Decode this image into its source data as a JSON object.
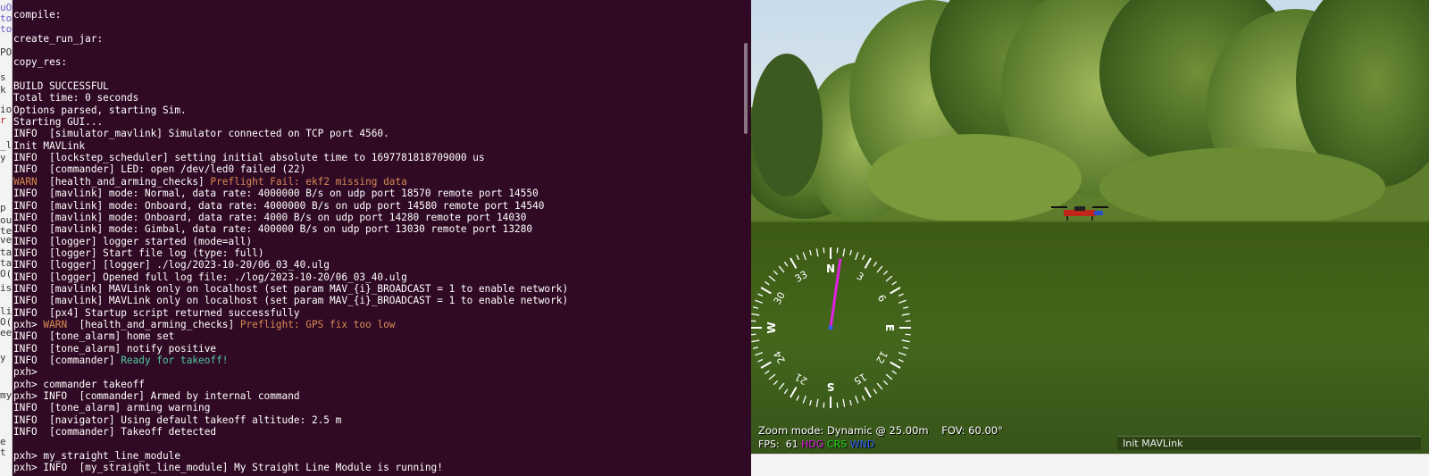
{
  "background_editor": {
    "fragments": [
      "uO",
      "to",
      "to",
      "PO",
      "k",
      "s",
      "io",
      "r",
      "_l",
      "y",
      "p",
      "ou",
      "te",
      "ve",
      "ta",
      "ta",
      "O(",
      "is",
      "li",
      "O(",
      "ee",
      "y",
      "my",
      "e",
      "t"
    ]
  },
  "terminal": {
    "lines": [
      [
        {
          "t": "compile:"
        }
      ],
      [
        {
          "t": ""
        }
      ],
      [
        {
          "t": "create_run_jar:"
        }
      ],
      [
        {
          "t": ""
        }
      ],
      [
        {
          "t": "copy_res:"
        }
      ],
      [
        {
          "t": ""
        }
      ],
      [
        {
          "t": "BUILD SUCCESSFUL"
        }
      ],
      [
        {
          "t": "Total time: 0 seconds"
        }
      ],
      [
        {
          "t": "Options parsed, starting Sim."
        }
      ],
      [
        {
          "t": "Starting GUI..."
        }
      ],
      [
        {
          "t": "INFO  [simulator_mavlink] Simulator connected on TCP port 4560."
        }
      ],
      [
        {
          "t": "Init MAVLink"
        }
      ],
      [
        {
          "t": "INFO  [lockstep_scheduler] setting initial absolute time to 1697781818709000 us"
        }
      ],
      [
        {
          "t": "INFO  [commander] LED: open /dev/led0 failed (22)"
        }
      ],
      [
        {
          "t": "WARN  ",
          "c": "warn"
        },
        {
          "t": "[health_and_arming_checks] "
        },
        {
          "t": "Preflight Fail: ekf2 missing data",
          "c": "warn"
        }
      ],
      [
        {
          "t": "INFO  [mavlink] mode: Normal, data rate: 4000000 B/s on udp port 18570 remote port 14550"
        }
      ],
      [
        {
          "t": "INFO  [mavlink] mode: Onboard, data rate: 4000000 B/s on udp port 14580 remote port 14540"
        }
      ],
      [
        {
          "t": "INFO  [mavlink] mode: Onboard, data rate: 4000 B/s on udp port 14280 remote port 14030"
        }
      ],
      [
        {
          "t": "INFO  [mavlink] mode: Gimbal, data rate: 400000 B/s on udp port 13030 remote port 13280"
        }
      ],
      [
        {
          "t": "INFO  [logger] logger started (mode=all)"
        }
      ],
      [
        {
          "t": "INFO  [logger] Start file log (type: full)"
        }
      ],
      [
        {
          "t": "INFO  [logger] [logger] ./log/2023-10-20/06_03_40.ulg"
        }
      ],
      [
        {
          "t": "INFO  [logger] Opened full log file: ./log/2023-10-20/06_03_40.ulg"
        }
      ],
      [
        {
          "t": "INFO  [mavlink] MAVLink only on localhost (set param MAV_{i}_BROADCAST = 1 to enable network)"
        }
      ],
      [
        {
          "t": "INFO  [mavlink] MAVLink only on localhost (set param MAV_{i}_BROADCAST = 1 to enable network)"
        }
      ],
      [
        {
          "t": "INFO  [px4] Startup script returned successfully"
        }
      ],
      [
        {
          "t": "pxh> "
        },
        {
          "t": "WARN  ",
          "c": "warn"
        },
        {
          "t": "[health_and_arming_checks] "
        },
        {
          "t": "Preflight: GPS fix too low",
          "c": "warn"
        }
      ],
      [
        {
          "t": "INFO  [tone_alarm] home set"
        }
      ],
      [
        {
          "t": "INFO  [tone_alarm] notify positive"
        }
      ],
      [
        {
          "t": "INFO  [commander] "
        },
        {
          "t": "Ready for takeoff!",
          "c": "ok"
        }
      ],
      [
        {
          "t": "pxh>"
        }
      ],
      [
        {
          "t": "pxh> commander takeoff"
        }
      ],
      [
        {
          "t": "pxh> INFO  [commander] Armed by internal command"
        }
      ],
      [
        {
          "t": "INFO  [tone_alarm] arming warning"
        }
      ],
      [
        {
          "t": "INFO  [navigator] Using default takeoff altitude: 2.5 m"
        }
      ],
      [
        {
          "t": "INFO  [commander] Takeoff detected"
        }
      ],
      [
        {
          "t": ""
        }
      ],
      [
        {
          "t": "pxh> my_straight_line_module"
        }
      ],
      [
        {
          "t": "pxh> INFO  [my_straight_line_module] My Straight Line Module is running!"
        }
      ]
    ]
  },
  "simulator": {
    "compass": {
      "heading_deg": 8,
      "cardinals": [
        "N",
        "E",
        "S",
        "W"
      ],
      "numbers": [
        "3",
        "6",
        "12",
        "15",
        "21",
        "24",
        "30",
        "33"
      ]
    },
    "hud_zoom": "Zoom mode: Dynamic @ 25.00m    FOV: 60.00°",
    "hud_fps_label": "FPS:",
    "hud_fps_value": "61",
    "hud_hdg": "HDG",
    "hud_crs": "CRS",
    "hud_wnd": "WND",
    "status_message": "Init MAVLink"
  },
  "colors": {
    "terminal_bg": "#300a24",
    "warn": "#d78a54",
    "ok": "#4ec9a0",
    "heading_needle": "#e020e0",
    "crs": "#22dd22",
    "wnd": "#3060ff"
  }
}
